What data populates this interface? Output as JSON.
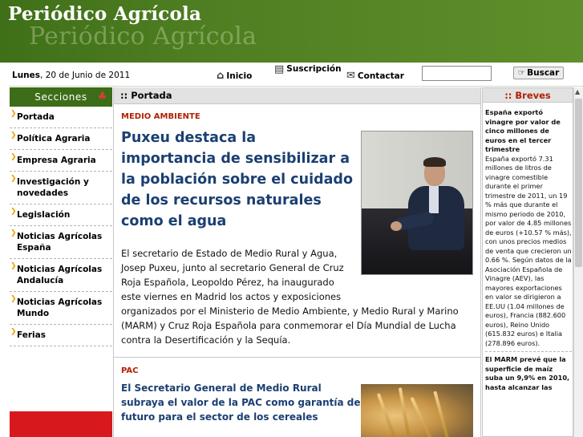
{
  "header": {
    "title": "Periódico Agrícola",
    "ghost_title": "Periódico Agrícola"
  },
  "topbar": {
    "date_weekday": "Lunes",
    "date_rest": ", 20 de Junio de 2011",
    "nav": {
      "inicio": "Inicio",
      "suscripcion": "Suscripción",
      "contactar": "Contactar"
    },
    "search": {
      "value": "",
      "button_label": "Buscar"
    }
  },
  "sidebar": {
    "heading": "Secciones",
    "items": [
      "Portada",
      "Política Agraria",
      "Empresa Agraria",
      "Investigación y novedades",
      "Legislación",
      "Noticias Agrícolas España",
      "Noticias Agrícolas Andalucía",
      "Noticias Agrícolas Mundo",
      "Ferias"
    ]
  },
  "main": {
    "breadcrumb": ":: Portada",
    "article1": {
      "section": "MEDIO AMBIENTE",
      "headline": "Puxeu destaca la importancia de sensibilizar a la población sobre el cuidado de los recursos naturales como el agua",
      "body_a": "El secretario de Estado de Medio Rural y Agua, Josep Puxeu, junto al secretario General de Cruz Roja Española, Leopoldo Pérez, ha inaugurado este viernes en Madrid los actos y exposiciones",
      "body_b": "organizados por el Ministerio de Medio Ambiente, y Medio Rural y Marino (MARM) y Cruz Roja Española para conmemorar el Día Mundial de Lucha contra la Desertificación y la Sequía."
    },
    "article2": {
      "section": "PAC",
      "headline": "El Secretario General de Medio Rural subraya el valor de la PAC como garantía de futuro para el sector de los cereales"
    }
  },
  "breves": {
    "heading": ":: Breves",
    "item1_title": "España exportó vinagre por valor de cinco millones de euros en el tercer trimestre",
    "item1_body": "España exportó 7.31 millones de litros de vinagre comestible durante el primer trimestre de 2011, un 19 % más que durante el mismo periodo de 2010, por valor de 4.85 millones de euros (+10.57 % más), con unos precios medios de venta que crecieron un 0.66 %. Según datos de la Asociación Española de Vinagre (AEV), las mayores exportaciones en valor se dirigieron a EE.UU (1.04 millones de euros), Francia (882.600 euros), Reino Unido (615.832 euros) e Italia (278.896 euros).",
    "item2_title": "El MARM prevé que la superficie de maíz suba un 9,9% en 2010, hasta alcanzar las"
  }
}
